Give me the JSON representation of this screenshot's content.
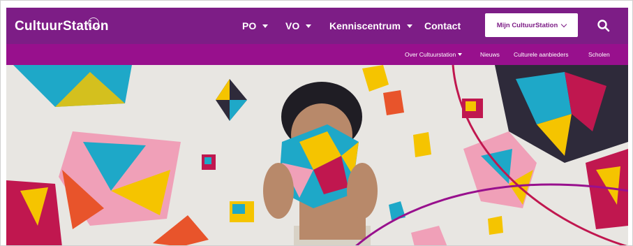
{
  "brand": {
    "logo_text": "CultuurStation",
    "primary_color": "#7d1d86",
    "secondary_color": "#98108d"
  },
  "main_nav": {
    "items": [
      {
        "label": "PO",
        "has_dropdown": true
      },
      {
        "label": "VO",
        "has_dropdown": true
      },
      {
        "label": "Kenniscentrum",
        "has_dropdown": true
      },
      {
        "label": "Contact",
        "has_dropdown": false
      }
    ],
    "account_button": "Mijn CultuurStation",
    "search_icon": "search-icon"
  },
  "sub_nav": {
    "items": [
      {
        "label": "Over Cultuurstation",
        "has_dropdown": true
      },
      {
        "label": "Nieuws",
        "has_dropdown": false
      },
      {
        "label": "Culturele aanbieders",
        "has_dropdown": false
      },
      {
        "label": "Scholen",
        "has_dropdown": false
      }
    ]
  },
  "hero": {
    "image_subject": "person holding colorful origami cube in front of face, surrounded by floating origami polyhedra and a paper crane",
    "accent_colors": [
      "#c0174f",
      "#f5c400",
      "#1ea8c8",
      "#e8542b",
      "#2e2a3a"
    ]
  }
}
